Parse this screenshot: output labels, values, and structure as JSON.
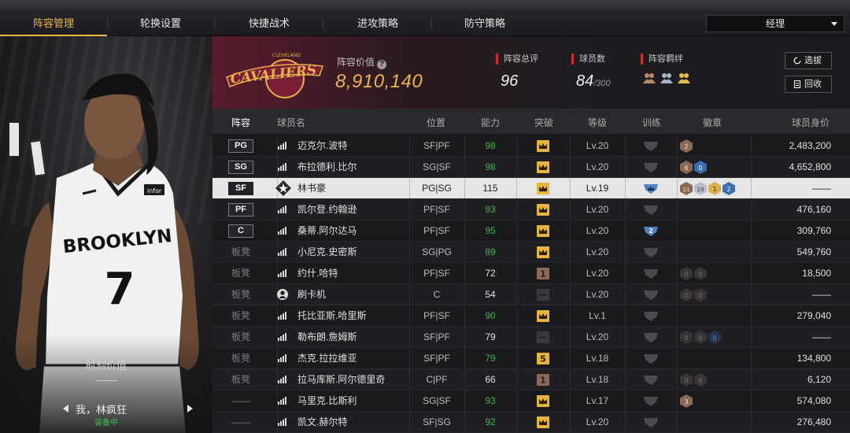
{
  "tabs": [
    "阵容管理",
    "轮换设置",
    "快捷战术",
    "进攻策略",
    "防守策略"
  ],
  "active_tab": 0,
  "manager_select": "经理",
  "player_panel": {
    "jersey_city": "BROOKLYN",
    "jersey_number": "7",
    "jersey_patch": "infor",
    "valuation_label": "时刻价值",
    "valuation_value": "——",
    "player_name": "我，林疯狂",
    "equipped_label": "装备中"
  },
  "summary": {
    "team_logo_text": "CAVALIERS",
    "team_logo_sub": "CLEVELAND",
    "lineup_value_label": "阵容价值",
    "lineup_value": "8,910,140",
    "rating_label": "阵容总评",
    "rating_value": "96",
    "roster_label": "球员数",
    "roster_count": "84",
    "roster_max": "/300",
    "bond_label": "阵容羁绊",
    "select_button": "选拔",
    "recycle_button": "回收"
  },
  "colors": {
    "accent": "#e9b648",
    "ability_green": "#43b24a",
    "team_wine": "#7a1f35",
    "team_gold": "#e5b24a"
  },
  "table": {
    "headers": [
      "阵容",
      "球员名",
      "位置",
      "能力",
      "突破",
      "等级",
      "训练",
      "徽章",
      "球员身价"
    ],
    "rows": [
      {
        "slot": "PG",
        "bench": false,
        "icon": "bars-icon",
        "name": "迈克尔.波特",
        "pos": "SF|PF",
        "ability": "98",
        "ability_green": true,
        "tp": "crown",
        "level": "Lv.20",
        "train": "",
        "badges": [
          {
            "t": "brown",
            "n": "2"
          }
        ],
        "value": "2,483,200"
      },
      {
        "slot": "SG",
        "bench": false,
        "icon": "bars-icon",
        "name": "布拉德利.比尔",
        "pos": "SG|SF",
        "ability": "98",
        "ability_green": true,
        "tp": "crown",
        "level": "Lv.20",
        "train": "",
        "badges": [
          {
            "t": "brown",
            "n": "6"
          },
          {
            "t": "blue",
            "n": "0"
          }
        ],
        "value": "4,652,800"
      },
      {
        "slot": "SF",
        "bench": false,
        "icon": "star-icon",
        "name": "林书豪",
        "pos": "PG|SG",
        "ability": "115",
        "ability_green": false,
        "tp": "crown",
        "level": "Lv.19",
        "train": "blue",
        "badges": [
          {
            "t": "brown",
            "n": "11"
          },
          {
            "t": "silver",
            "n": "19"
          },
          {
            "t": "gold",
            "n": "1"
          },
          {
            "t": "blue",
            "n": "2"
          }
        ],
        "value": "——",
        "selected": true
      },
      {
        "slot": "PF",
        "bench": false,
        "icon": "bars-icon",
        "name": "凯尔登.约翰逊",
        "pos": "PF|SF",
        "ability": "93",
        "ability_green": true,
        "tp": "crown",
        "level": "Lv.20",
        "train": "",
        "badges": [],
        "value": "476,160"
      },
      {
        "slot": "C",
        "bench": false,
        "icon": "bars-icon",
        "name": "桑蒂.阿尔达马",
        "pos": "PF|SF",
        "ability": "95",
        "ability_green": true,
        "tp": "crown",
        "level": "Lv.20",
        "train": "blue2",
        "train_num": "2",
        "badges": [],
        "value": "309,760"
      },
      {
        "slot": "板凳",
        "bench": true,
        "icon": "bars-icon",
        "name": "小尼克.史密斯",
        "pos": "SG|PG",
        "ability": "89",
        "ability_green": true,
        "tp": "crown",
        "level": "Lv.20",
        "train": "",
        "badges": [],
        "value": "549,760"
      },
      {
        "slot": "板凳",
        "bench": true,
        "icon": "bars-icon",
        "name": "约什.哈特",
        "pos": "PF|SF",
        "ability": "72",
        "ability_green": false,
        "tp": "num1",
        "tp_num": "1",
        "level": "Lv.20",
        "train": "",
        "badges": [
          {
            "t": "dark",
            "n": "0"
          },
          {
            "t": "dark",
            "n": "0"
          }
        ],
        "value": "18,500"
      },
      {
        "slot": "板凳",
        "bench": true,
        "icon": "person-icon",
        "name": "刷卡机",
        "pos": "C",
        "ability": "54",
        "ability_green": false,
        "tp": "none",
        "level": "Lv.20",
        "train": "",
        "badges": [
          {
            "t": "dark",
            "n": "0"
          },
          {
            "t": "dark",
            "n": "0"
          }
        ],
        "value": "——"
      },
      {
        "slot": "板凳",
        "bench": true,
        "icon": "bars-icon",
        "name": "托比亚斯.哈里斯",
        "pos": "PF|SF",
        "ability": "90",
        "ability_green": true,
        "tp": "crown",
        "level": "Lv.1",
        "train": "",
        "badges": [],
        "value": "279,040"
      },
      {
        "slot": "板凳",
        "bench": true,
        "icon": "bars-icon",
        "name": "勒布朗.詹姆斯",
        "pos": "SF|PF",
        "ability": "79",
        "ability_green": false,
        "tp": "none",
        "level": "Lv.20",
        "train": "",
        "badges": [
          {
            "t": "dark",
            "n": "0"
          },
          {
            "t": "dark",
            "n": "0"
          },
          {
            "t": "darkblue",
            "n": "0"
          }
        ],
        "value": "——"
      },
      {
        "slot": "板凳",
        "bench": true,
        "icon": "bars-icon",
        "name": "杰克.拉拉维亚",
        "pos": "SF|PF",
        "ability": "79",
        "ability_green": true,
        "tp": "num5",
        "tp_num": "5",
        "level": "Lv.18",
        "train": "",
        "badges": [],
        "value": "134,800"
      },
      {
        "slot": "板凳",
        "bench": true,
        "icon": "bars-icon",
        "name": "拉马库斯.阿尔德里奇",
        "pos": "C|PF",
        "ability": "66",
        "ability_green": false,
        "tp": "num1",
        "tp_num": "1",
        "level": "Lv.18",
        "train": "",
        "badges": [
          {
            "t": "dark",
            "n": "0"
          },
          {
            "t": "dark",
            "n": "0"
          }
        ],
        "value": "6,120"
      },
      {
        "slot": "——",
        "bench": true,
        "icon": "bars-icon",
        "name": "马里克.比斯利",
        "pos": "SG|SF",
        "ability": "93",
        "ability_green": true,
        "tp": "crown",
        "level": "Lv.17",
        "train": "",
        "badges": [
          {
            "t": "brown",
            "n": "3"
          }
        ],
        "value": "574,080"
      },
      {
        "slot": "——",
        "bench": true,
        "icon": "bars-icon",
        "name": "凯文.赫尔特",
        "pos": "SF|SG",
        "ability": "92",
        "ability_green": true,
        "tp": "crown",
        "level": "Lv.20",
        "train": "",
        "badges": [],
        "value": "276,480"
      }
    ]
  }
}
